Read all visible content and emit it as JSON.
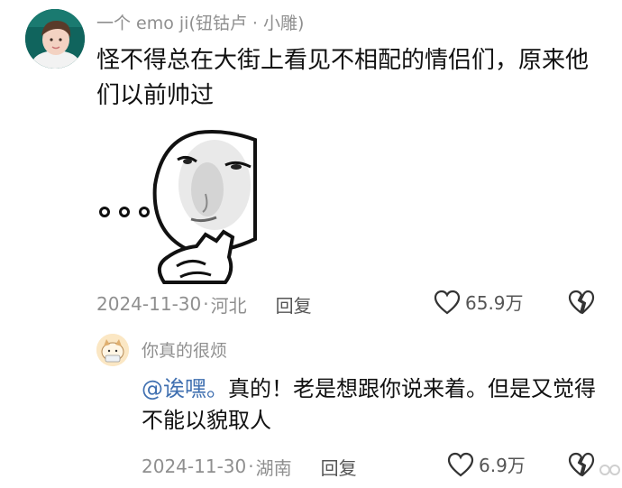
{
  "comment": {
    "username": "一个 emo ji(钮钴卢 · 小雕)",
    "text": "怪不得总在大街上看见不相配的情侣们，原来他们以前帅过",
    "date": "2024-11-30",
    "separator": "·",
    "location": "河北",
    "reply_label": "回复",
    "likes": "65.9万",
    "icons": {
      "avatar": "avatar-photo",
      "sticker": "thinking-face-sticker",
      "like": "heart-outline-icon",
      "dislike": "broken-heart-icon"
    }
  },
  "reply": {
    "username": "你真的很烦",
    "mention": "@诶嘿。",
    "text": "真的！老是想跟你说来着。但是又觉得不能以貌取人",
    "date": "2024-11-30",
    "separator": "·",
    "location": "湖南",
    "reply_label": "回复",
    "likes": "6.9万",
    "icons": {
      "avatar": "cartoon-avatar",
      "like": "heart-outline-icon",
      "dislike": "broken-heart-icon"
    }
  },
  "colors": {
    "mention": "#3f6fb0",
    "meta_text": "#8f8f8f",
    "body_text": "#111111"
  }
}
